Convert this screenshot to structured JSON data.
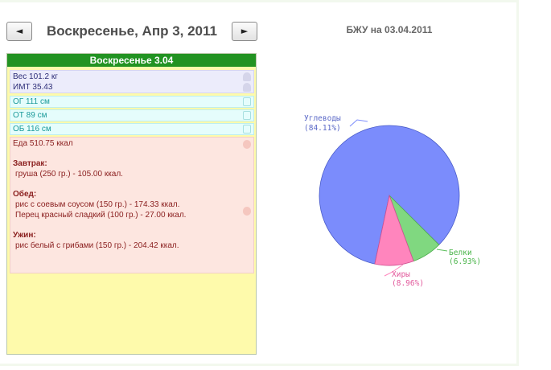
{
  "nav": {
    "prev": "◄",
    "next": "►",
    "date_title": "Воскресенье, Апр 3, 2011"
  },
  "day": {
    "header": "Воскресенье 3.04",
    "weight": "Вес 101.2 кг",
    "bmi": "ИМТ 35.43",
    "og": "ОГ 111 см",
    "ot": "ОТ 89 см",
    "ob": "ОБ 116 см",
    "food_total": "Еда 510.75 ккал",
    "meals": [
      {
        "name": "Завтрак:",
        "items": [
          "груша (250 гр.) - 105.00 ккал."
        ]
      },
      {
        "name": "Обед:",
        "items": [
          "рис с соевым соусом (150 гр.) - 174.33 ккал.",
          "Перец красный сладкий (100 гр.) - 27.00 ккал."
        ]
      },
      {
        "name": "Ужин:",
        "items": [
          "рис белый с грибами (150 гр.) - 204.42 ккал."
        ]
      }
    ]
  },
  "colors": {
    "header_green": "#229322",
    "carbs": "#7b8cfc",
    "fat": "#ff85bd",
    "protein": "#80d880"
  },
  "chart_data": {
    "type": "pie",
    "title": "БЖУ на 03.04.2011",
    "slices": [
      {
        "name": "Углеводы",
        "value": 84.11,
        "label": "(84.11%)",
        "color": "#7b8cfc"
      },
      {
        "name": "Хиры",
        "value": 8.96,
        "label": "(8.96%)",
        "color": "#ff85bd"
      },
      {
        "name": "Белки",
        "value": 6.93,
        "label": "(6.93%)",
        "color": "#80d880"
      }
    ]
  }
}
